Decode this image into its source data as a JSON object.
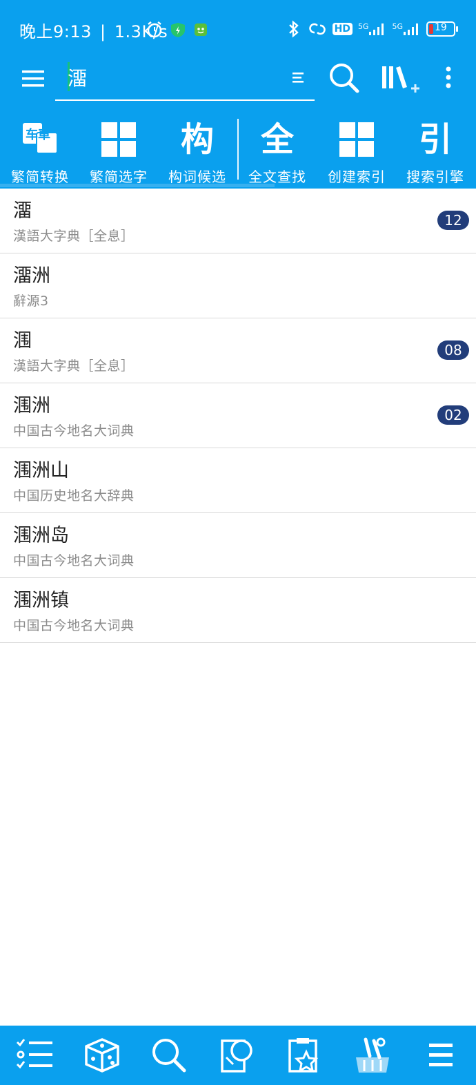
{
  "status": {
    "time": "晚上9:13",
    "speed": "1.3K/s",
    "hd": "HD",
    "net1": "5G",
    "net2": "5G",
    "battery": "19"
  },
  "search": {
    "value": "澑"
  },
  "toolbar": {
    "tools": [
      {
        "label": "繁简转换",
        "glyph": "车車"
      },
      {
        "label": "繁简选字",
        "glyph": ""
      },
      {
        "label": "构词候选",
        "glyph": "构"
      },
      {
        "label": "全文查找",
        "glyph": "全"
      },
      {
        "label": "创建索引",
        "glyph": ""
      },
      {
        "label": "搜索引擎",
        "glyph": "引"
      }
    ]
  },
  "results": [
    {
      "term": "澑",
      "source": "漢語大字典［全息］",
      "badge": "12"
    },
    {
      "term": "澑洲",
      "source": "辭源3",
      "badge": ""
    },
    {
      "term": "涠",
      "source": "漢語大字典［全息］",
      "badge": "08"
    },
    {
      "term": "涠洲",
      "source": "中国古今地名大词典",
      "badge": "02"
    },
    {
      "term": "涠洲山",
      "source": "中国历史地名大辞典",
      "badge": ""
    },
    {
      "term": "涠洲岛",
      "source": "中国古今地名大词典",
      "badge": ""
    },
    {
      "term": "涠洲镇",
      "source": "中国古今地名大词典",
      "badge": ""
    }
  ],
  "colors": {
    "primary": "#0aa0ee",
    "badge": "#223d7a",
    "cursor": "#17c17a"
  }
}
